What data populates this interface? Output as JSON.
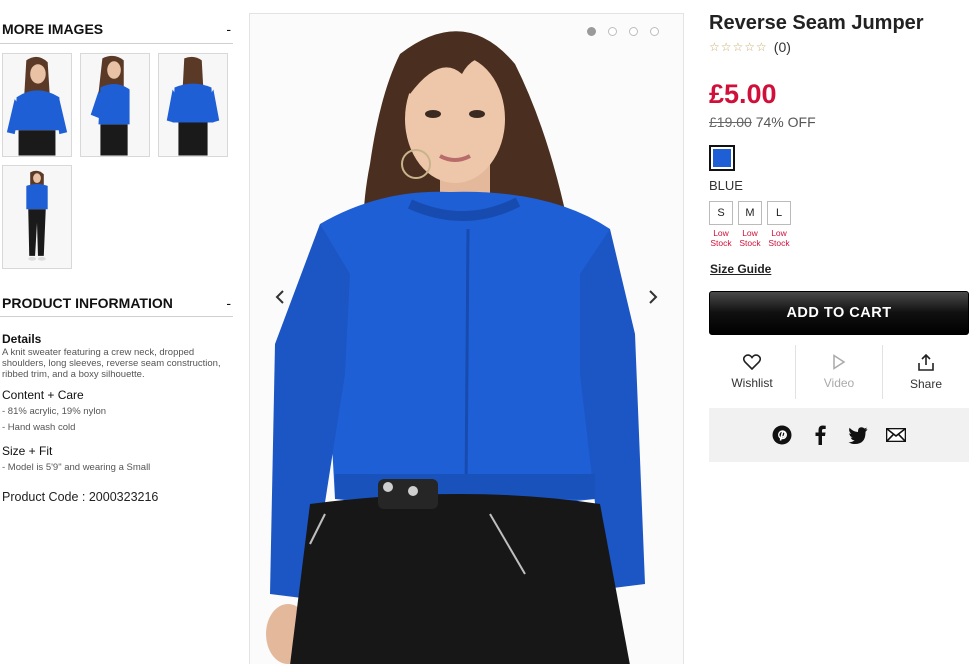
{
  "left": {
    "more_images": {
      "heading": "MORE IMAGES",
      "toggle": "-"
    },
    "product_information": {
      "heading": "PRODUCT INFORMATION",
      "toggle": "-",
      "details_title": "Details",
      "details_text": "A knit sweater featuring a crew neck, dropped shoulders, long sleeves, reverse seam construction, ribbed trim, and a boxy silhouette.",
      "content_title": "Content + Care",
      "content_items": [
        "- 81% acrylic, 19% nylon",
        "- Hand wash cold"
      ],
      "fit_title": "Size + Fit",
      "fit_items": [
        "- Model is 5'9\" and wearing a Small"
      ],
      "product_code": "Product Code : 2000323216"
    }
  },
  "product": {
    "title": "Reverse Seam Jumper",
    "stars": "☆☆☆☆☆",
    "rating_count": "(0)",
    "rating_value": 0,
    "price": "£5.00",
    "was_price": "£19.00",
    "discount": "74% OFF",
    "color_name": "BLUE",
    "color_hex": "#1f5fd6",
    "sizes": [
      {
        "label": "S",
        "stock_line1": "Low",
        "stock_line2": "Stock"
      },
      {
        "label": "M",
        "stock_line1": "Low",
        "stock_line2": "Stock"
      },
      {
        "label": "L",
        "stock_line1": "Low",
        "stock_line2": "Stock"
      }
    ],
    "size_guide": "Size Guide",
    "add_to_cart": "ADD TO CART",
    "actions": {
      "wishlist": "Wishlist",
      "video": "Video",
      "share": "Share"
    }
  },
  "gallery": {
    "slide_count": 4,
    "active_slide": 1
  },
  "colors": {
    "accent_price": "#d0103a",
    "sweater_blue": "#1f5fd6"
  }
}
